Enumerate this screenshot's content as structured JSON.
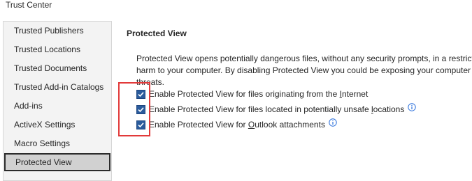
{
  "window": {
    "title": "Trust Center"
  },
  "sidebar": {
    "items": [
      {
        "label": "Trusted Publishers",
        "selected": false
      },
      {
        "label": "Trusted Locations",
        "selected": false
      },
      {
        "label": "Trusted Documents",
        "selected": false
      },
      {
        "label": "Trusted Add-in Catalogs",
        "selected": false
      },
      {
        "label": "Add-ins",
        "selected": false
      },
      {
        "label": "ActiveX Settings",
        "selected": false
      },
      {
        "label": "Macro Settings",
        "selected": false
      },
      {
        "label": "Protected View",
        "selected": true
      }
    ]
  },
  "main": {
    "section_title": "Protected View",
    "description_lines": [
      "Protected View opens potentially dangerous files, without any security prompts, in a restrict",
      "harm to your computer. By disabling Protected View you could be exposing your computer",
      "threats."
    ],
    "options": [
      {
        "pre": "Enable Protected View for files originating from the ",
        "accel": "I",
        "post": "nternet",
        "checked": true,
        "info": false
      },
      {
        "pre": "Enable Protected View for files located in potentially unsafe ",
        "accel": "l",
        "post": "ocations",
        "checked": true,
        "info": true
      },
      {
        "pre": "Enable Protected View for ",
        "accel": "O",
        "post": "utlook attachments",
        "checked": true,
        "info": true
      }
    ]
  },
  "colors": {
    "checkbox_fill": "#2a5b9c",
    "highlight_border": "#e23a3a",
    "info_icon": "#2a6fdb"
  }
}
